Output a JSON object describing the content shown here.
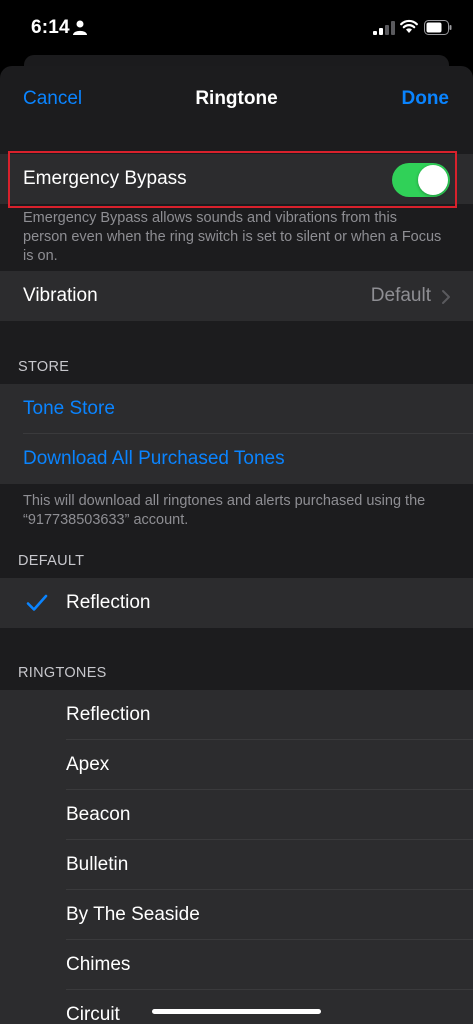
{
  "status_bar": {
    "time": "6:14"
  },
  "nav": {
    "cancel": "Cancel",
    "title": "Ringtone",
    "done": "Done"
  },
  "emergency": {
    "label": "Emergency Bypass",
    "enabled": true,
    "footnote": "Emergency Bypass allows sounds and vibrations from this person even when the ring switch is set to silent or when a Focus is on."
  },
  "vibration": {
    "label": "Vibration",
    "value": "Default"
  },
  "store": {
    "header": "STORE",
    "tone_store": "Tone Store",
    "download_all": "Download All Purchased Tones",
    "footnote": "This will download all ringtones and alerts purchased using the “917738503633” account."
  },
  "default_section": {
    "header": "DEFAULT",
    "selected": "Reflection"
  },
  "ringtones": {
    "header": "RINGTONES",
    "items": [
      "Reflection",
      "Apex",
      "Beacon",
      "Bulletin",
      "By The Seaside",
      "Chimes",
      "Circuit"
    ]
  },
  "colors": {
    "accent": "#0a84ff",
    "toggle_on": "#30d158",
    "highlight": "#d9212c"
  }
}
